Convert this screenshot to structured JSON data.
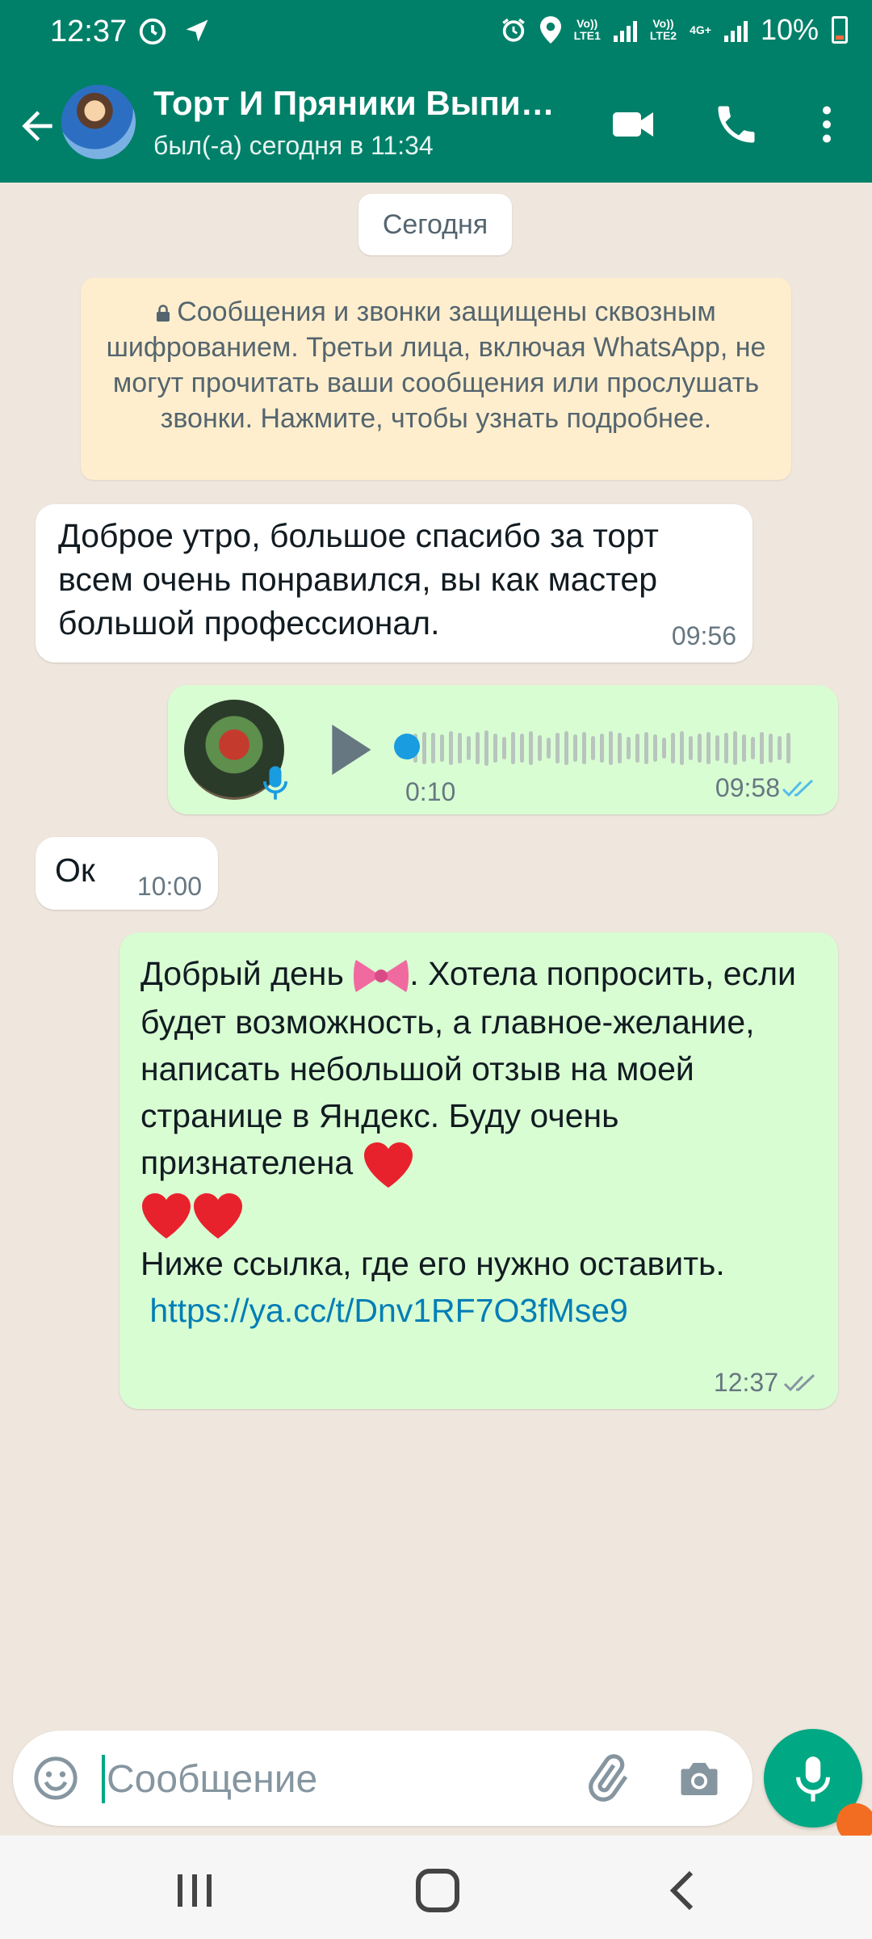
{
  "status_bar": {
    "time": "12:37",
    "sim1_label": "Vo))\nLTE1",
    "sim2_label": "Vo))\nLTE2",
    "data_label": "4G+",
    "battery_text": "10%"
  },
  "header": {
    "title": "Торт И Пряники Выпи…",
    "subtitle": "был(-а) сегодня в 11:34"
  },
  "chat": {
    "date_chip": "Сегодня",
    "encryption_notice": "Сообщения и звонки защищены сквозным шифрованием. Третьи лица, включая WhatsApp, не могут прочитать ваши сообщения или прослушать звонки. Нажмите, чтобы узнать подробнее.",
    "messages": [
      {
        "direction": "incoming",
        "text": "Доброе утро, большое спасибо за торт всем очень понравился, вы как мастер большой профессионал.",
        "time": "09:56"
      },
      {
        "direction": "outgoing",
        "type": "voice",
        "duration": "0:10",
        "time": "09:58",
        "status": "read"
      },
      {
        "direction": "incoming",
        "text": "Ок",
        "time": "10:00"
      },
      {
        "direction": "outgoing",
        "text_part1": "Добрый день",
        "text_part2": ".  Хотела попросить, если будет возможность,  а главное-желание,  написать небольшой отзыв на моей странице в Яндекс.  Буду очень признателена",
        "text_part3": "Ниже ссылка, где его нужно оставить.",
        "link": "https://ya.cc/t/Dnv1RF7O3fMse9",
        "time": "12:37",
        "status": "delivered"
      }
    ]
  },
  "composer": {
    "placeholder": "Сообщение"
  },
  "colors": {
    "brand": "#008069",
    "accent": "#00a884",
    "outgoing_bubble": "#d9fdd3",
    "incoming_bubble": "#ffffff",
    "notice_bg": "#ffeecd",
    "link": "#027eb5",
    "read_ticks": "#53bdeb"
  }
}
